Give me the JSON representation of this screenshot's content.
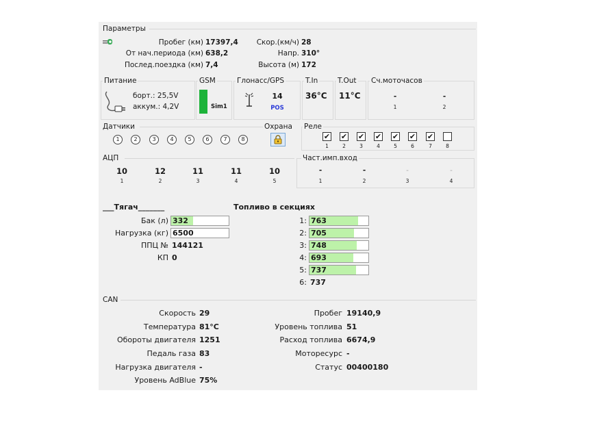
{
  "params": {
    "title": "Параметры",
    "mileage_label": "Пробег (км)",
    "mileage_value": "17397,4",
    "since_period_label": "От нач.периода (км)",
    "since_period_value": "638,2",
    "last_trip_label": "Послед.поездка (км)",
    "last_trip_value": "7,4",
    "speed_label": "Скор.(км/ч)",
    "speed_value": "28",
    "direction_label": "Напр.",
    "direction_value": "310°",
    "altitude_label": "Высота (м)",
    "altitude_value": "172"
  },
  "power": {
    "title": "Питание",
    "board_label": "борт.: 25,5V",
    "battery_label": "аккум.: 4,2V"
  },
  "gsm": {
    "title": "GSM",
    "sim_label": "Sim1",
    "signal_color": "#1db33a"
  },
  "gps": {
    "title": "Глонасс/GPS",
    "sat_count": "14",
    "pos_label": "POS"
  },
  "tin": {
    "title": "T.In",
    "value": "36°C"
  },
  "tout": {
    "title": "T.Out",
    "value": "11°C"
  },
  "hours": {
    "title": "Сч.моточасов",
    "items": [
      {
        "value": "-",
        "num": "1"
      },
      {
        "value": "-",
        "num": "2"
      }
    ]
  },
  "sensors": {
    "title": "Датчики",
    "items": [
      "1",
      "2",
      "3",
      "4",
      "5",
      "6",
      "7",
      "8"
    ]
  },
  "guard": {
    "title": "Охрана"
  },
  "relays": {
    "title": "Реле",
    "items": [
      {
        "num": "1",
        "mark": "✔"
      },
      {
        "num": "2",
        "mark": "✔"
      },
      {
        "num": "3",
        "mark": "✔"
      },
      {
        "num": "4",
        "mark": "✔"
      },
      {
        "num": "5",
        "mark": "✔"
      },
      {
        "num": "6",
        "mark": "✔"
      },
      {
        "num": "7",
        "mark": "✔"
      },
      {
        "num": "8",
        "mark": ""
      }
    ]
  },
  "adc": {
    "title": "АЦП",
    "items": [
      {
        "value": "10",
        "num": "1"
      },
      {
        "value": "12",
        "num": "2"
      },
      {
        "value": "11",
        "num": "3"
      },
      {
        "value": "11",
        "num": "4"
      },
      {
        "value": "10",
        "num": "5"
      }
    ]
  },
  "freq": {
    "title": "Част.имп.вход",
    "items": [
      {
        "value": "-",
        "num": "1"
      },
      {
        "value": "-",
        "num": "2"
      },
      {
        "value": "-",
        "num": "3"
      },
      {
        "value": "-",
        "num": "4"
      }
    ]
  },
  "tractor": {
    "title": "___Тягач_______",
    "tank_label": "Бак (л)",
    "tank_value": "332",
    "tank_fill": 0.38,
    "load_label": "Нагрузка (кг)",
    "load_value": "6500",
    "load_fill": 0,
    "ppc_label": "ППЦ №",
    "ppc_value": "144121",
    "kp_label": "КП",
    "kp_value": "0"
  },
  "fuel_sections": {
    "title": "Топливо в секциях",
    "items": [
      {
        "label": "1:",
        "value": "763",
        "fill": 0.82
      },
      {
        "label": "2:",
        "value": "705",
        "fill": 0.75
      },
      {
        "label": "3:",
        "value": "748",
        "fill": 0.8
      },
      {
        "label": "4:",
        "value": "693",
        "fill": 0.74
      },
      {
        "label": "5:",
        "value": "737",
        "fill": 0.79
      },
      {
        "label": "6:",
        "value": "737",
        "fill": null
      }
    ]
  },
  "can": {
    "title": "CAN",
    "speed_label": "Скорость",
    "speed_value": "29",
    "temp_label": "Температура",
    "temp_value": "81°C",
    "rpm_label": "Обороты двигателя",
    "rpm_value": "1251",
    "pedal_label": "Педаль газа",
    "pedal_value": "83",
    "engine_load_label": "Нагрузка двигателя",
    "engine_load_value": "-",
    "adblue_label": "Уровень AdBlue",
    "adblue_value": "75%",
    "mileage_label": "Пробег",
    "mileage_value": "19140,9",
    "fuel_level_label": "Уровень топлива",
    "fuel_level_value": "51",
    "fuel_cons_label": "Расход топлива",
    "fuel_cons_value": "6674,9",
    "motor_label": "Моторесурс",
    "motor_value": "-",
    "status_label": "Статус",
    "status_value": "00400180"
  }
}
